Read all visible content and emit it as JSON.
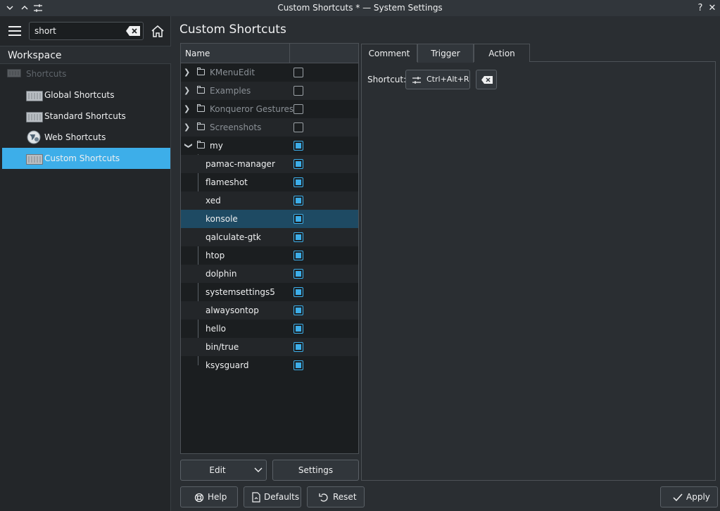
{
  "window": {
    "title": "Custom Shortcuts * — System Settings",
    "help_label": "?",
    "close_label": "✕"
  },
  "sidebar": {
    "search": {
      "value": "short",
      "placeholder": ""
    },
    "workspace_label": "Workspace",
    "category": "Shortcuts",
    "items": [
      {
        "label": "Global Shortcuts",
        "icon": "keyboard-icon"
      },
      {
        "label": "Standard Shortcuts",
        "icon": "keyboard-icon"
      },
      {
        "label": "Web Shortcuts",
        "icon": "globe-icon"
      },
      {
        "label": "Custom Shortcuts",
        "icon": "keyboard-icon",
        "selected": true
      }
    ]
  },
  "main": {
    "title": "Custom Shortcuts",
    "tree": {
      "header": "Name",
      "groups": [
        {
          "label": "KMenuEdit",
          "checked": false
        },
        {
          "label": "Examples",
          "checked": false
        },
        {
          "label": "Konqueror Gestures",
          "checked": false
        },
        {
          "label": "Screenshots",
          "checked": false
        },
        {
          "label": "my",
          "checked": true
        }
      ],
      "children": [
        {
          "label": "pamac-manager",
          "checked": true
        },
        {
          "label": "flameshot",
          "checked": true
        },
        {
          "label": "xed",
          "checked": true
        },
        {
          "label": "konsole",
          "checked": true,
          "selected": true
        },
        {
          "label": "qalculate-gtk",
          "checked": true
        },
        {
          "label": "htop",
          "checked": true
        },
        {
          "label": "dolphin",
          "checked": true
        },
        {
          "label": "systemsettings5",
          "checked": true
        },
        {
          "label": "alwaysontop",
          "checked": true
        },
        {
          "label": "hello",
          "checked": true
        },
        {
          "label": "bin/true",
          "checked": true
        },
        {
          "label": "ksysguard",
          "checked": true
        }
      ]
    },
    "edit_button": "Edit",
    "settings_button": "Settings",
    "tabs": [
      "Comment",
      "Trigger",
      "Action"
    ],
    "active_tab": "Trigger",
    "shortcut_label": "Shortcut:",
    "shortcut_value": "Ctrl+Alt+R"
  },
  "footer": {
    "help": "Help",
    "defaults": "Defaults",
    "reset": "Reset",
    "apply": "Apply"
  },
  "colors": {
    "accent": "#3daee9",
    "background": "#2a2e32",
    "selection_row": "#1e4a63"
  }
}
